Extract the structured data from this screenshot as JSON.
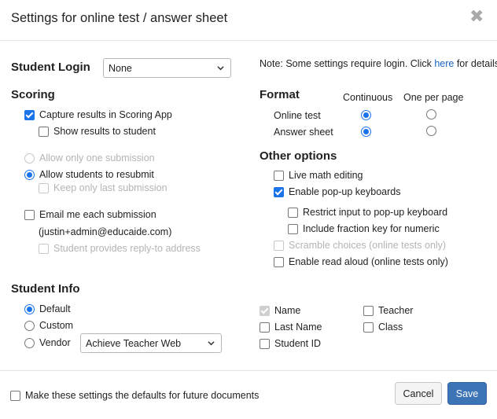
{
  "dialog": {
    "title": "Settings for online test / answer sheet"
  },
  "note": {
    "text": "Note: Some settings require login. Click ",
    "link": "here",
    "suffix": " for details."
  },
  "student_login": {
    "label": "Student Login",
    "value": "None"
  },
  "scoring": {
    "heading": "Scoring",
    "capture": "Capture results in Scoring App",
    "show_results": "Show results to student",
    "allow_one": "Allow only one submission",
    "allow_resubmit": "Allow students to resubmit",
    "keep_last": "Keep only last submission",
    "email_me": "Email me each submission",
    "email_addr": "(justin+admin@educaide.com)",
    "reply_to": "Student provides reply-to address"
  },
  "format": {
    "heading": "Format",
    "col_continuous": "Continuous",
    "col_one_per_page": "One per page",
    "online_test": "Online test",
    "answer_sheet": "Answer sheet"
  },
  "other_options": {
    "heading": "Other options",
    "live_math": "Live math editing",
    "popup_keyboards": "Enable pop-up keyboards",
    "restrict_input": "Restrict input to pop-up keyboard",
    "fraction_key": "Include fraction key for numeric",
    "scramble": "Scramble choices (online tests only)",
    "read_aloud": "Enable read aloud (online tests only)"
  },
  "student_info": {
    "heading": "Student Info",
    "default": "Default",
    "custom": "Custom",
    "vendor": "Vendor",
    "vendor_value": "Achieve Teacher Web",
    "name": "Name",
    "last_name": "Last Name",
    "student_id": "Student ID",
    "teacher": "Teacher",
    "class": "Class"
  },
  "footer": {
    "defaults": "Make these settings the defaults for future documents",
    "cancel": "Cancel",
    "save": "Save"
  },
  "colors": {
    "accent": "#1a73e8",
    "save_button": "#3c74b6",
    "link": "#1a62c4",
    "disabled": "#b4b4b4"
  }
}
